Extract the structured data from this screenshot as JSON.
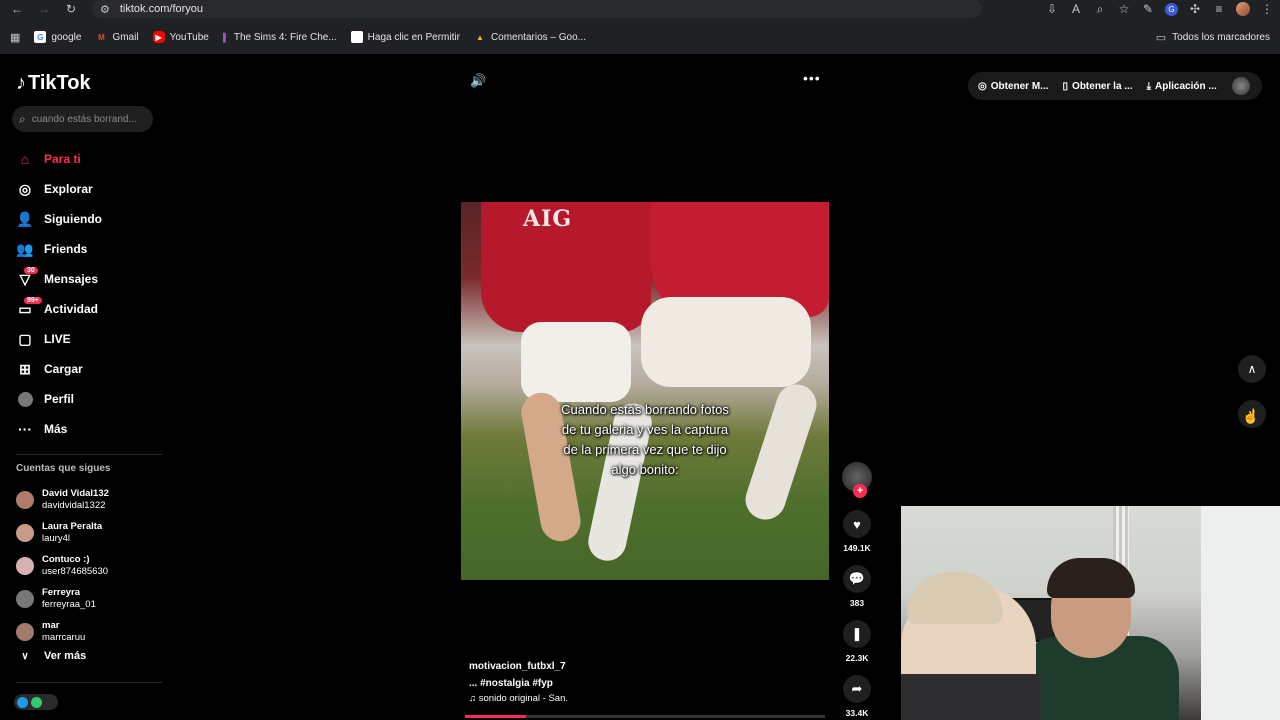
{
  "browser": {
    "url": "tiktok.com/foryou",
    "bookmarks": [
      {
        "label": "google",
        "icon": "google-icon",
        "color": "#4285f4"
      },
      {
        "label": "Gmail",
        "icon": "gmail-icon",
        "color": "#ea4335"
      },
      {
        "label": "YouTube",
        "icon": "youtube-icon",
        "color": "#ff0000"
      },
      {
        "label": "The Sims 4: Fire Che...",
        "icon": "sims-icon",
        "color": "#7b3fa0"
      },
      {
        "label": "Haga clic en Permitir",
        "icon": "page-icon",
        "color": "#ffffff"
      },
      {
        "label": "Comentarios – Goo...",
        "icon": "drive-icon",
        "color": "#fbbc04"
      }
    ],
    "all_bookmarks": "Todos los marcadores"
  },
  "tiktok": {
    "brand": "TikTok",
    "search_placeholder": "cuando estás borrand...",
    "menu": [
      {
        "label": "Para ti",
        "icon": "home-icon",
        "active": true
      },
      {
        "label": "Explorar",
        "icon": "compass-icon"
      },
      {
        "label": "Siguiendo",
        "icon": "following-icon"
      },
      {
        "label": "Friends",
        "icon": "friends-icon"
      },
      {
        "label": "Mensajes",
        "icon": "messages-icon",
        "badge": "30"
      },
      {
        "label": "Actividad",
        "icon": "activity-icon",
        "badge": "99+"
      },
      {
        "label": "LIVE",
        "icon": "live-icon"
      },
      {
        "label": "Cargar",
        "icon": "upload-icon"
      },
      {
        "label": "Perfil",
        "icon": "profile-avatar-icon"
      },
      {
        "label": "Más",
        "icon": "more-icon"
      }
    ],
    "following_title": "Cuentas que sigues",
    "following": [
      {
        "name": "David Vidal132",
        "handle": "davidvidal1322",
        "color": "#b07b6a"
      },
      {
        "name": "Laura Peralta",
        "handle": "laury4l",
        "color": "#c99a8a"
      },
      {
        "name": "Contuco :)",
        "handle": "user874685630",
        "color": "#d8b0b0"
      },
      {
        "name": "Ferreyra",
        "handle": "ferreyraa_01",
        "color": "#777777"
      },
      {
        "name": "mar",
        "handle": "marrcaruu",
        "color": "#a07a6c"
      }
    ],
    "see_more": "Ver más",
    "top_actions": [
      {
        "label": "Obtener M...",
        "icon": "coin-icon"
      },
      {
        "label": "Obtener la ...",
        "icon": "phone-icon"
      },
      {
        "label": "Aplicación ...",
        "icon": "download-icon"
      }
    ],
    "video": {
      "overlay_logo": "AIG",
      "caption_lines": [
        "Cuando estás borrando fotos",
        "de tu galeria y ves la captura",
        "de la primera vez que te dijo",
        "algo bonito:"
      ],
      "username": "motivacion_futbxl_7",
      "tags": "... #nostalgia  #fyp",
      "sound": "sonido original - San.",
      "progress": 0.17,
      "likes": "149.1K",
      "comments": "383",
      "saves": "22.3K",
      "shares": "33.4K"
    }
  }
}
